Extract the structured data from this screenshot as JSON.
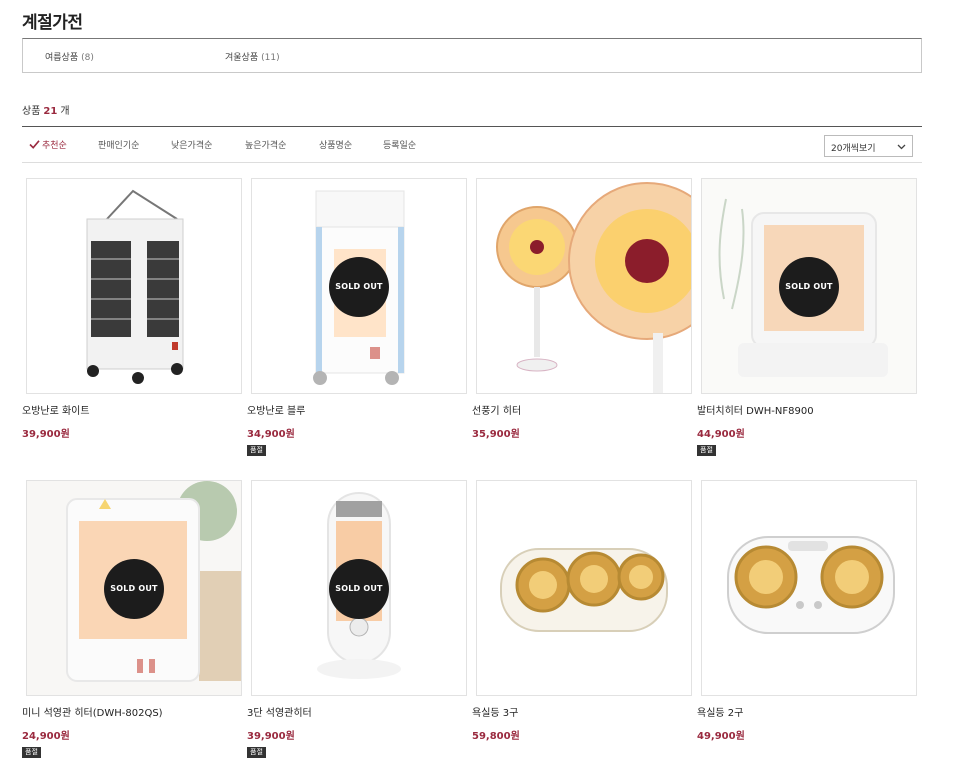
{
  "page": {
    "title": "계절가전"
  },
  "categories": [
    {
      "label": "여름상품",
      "count": "(8)"
    },
    {
      "label": "겨울상품",
      "count": "(11)"
    }
  ],
  "summary": {
    "prefix": "상품",
    "count": "21",
    "suffix": "개"
  },
  "sort": {
    "options": [
      "추천순",
      "판매인기순",
      "낮은가격순",
      "높은가격순",
      "상품명순",
      "등록일순"
    ],
    "active_index": 0,
    "per_page": "20개씩보기"
  },
  "accent_color": "#9a2a3f",
  "products": [
    {
      "name": "오방난로 화이트",
      "price": "39,900원",
      "sold_out": false,
      "badge": ""
    },
    {
      "name": "오방난로 블루",
      "price": "34,900원",
      "sold_out": true,
      "sold_out_label": "SOLD OUT",
      "badge": "품절"
    },
    {
      "name": "선풍기 히터",
      "price": "35,900원",
      "sold_out": false,
      "badge": ""
    },
    {
      "name": "발터치히터 DWH-NF8900",
      "price": "44,900원",
      "sold_out": true,
      "sold_out_label": "SOLD OUT",
      "badge": "품절"
    },
    {
      "name": "미니 석영관 히터(DWH-802QS)",
      "price": "24,900원",
      "sold_out": true,
      "sold_out_label": "SOLD OUT",
      "badge": "품절"
    },
    {
      "name": "3단 석영관히터",
      "price": "39,900원",
      "sold_out": true,
      "sold_out_label": "SOLD OUT",
      "badge": "품절"
    },
    {
      "name": "욕실등 3구",
      "price": "59,800원",
      "sold_out": false,
      "badge": ""
    },
    {
      "name": "욕실등 2구",
      "price": "49,900원",
      "sold_out": false,
      "badge": ""
    }
  ]
}
